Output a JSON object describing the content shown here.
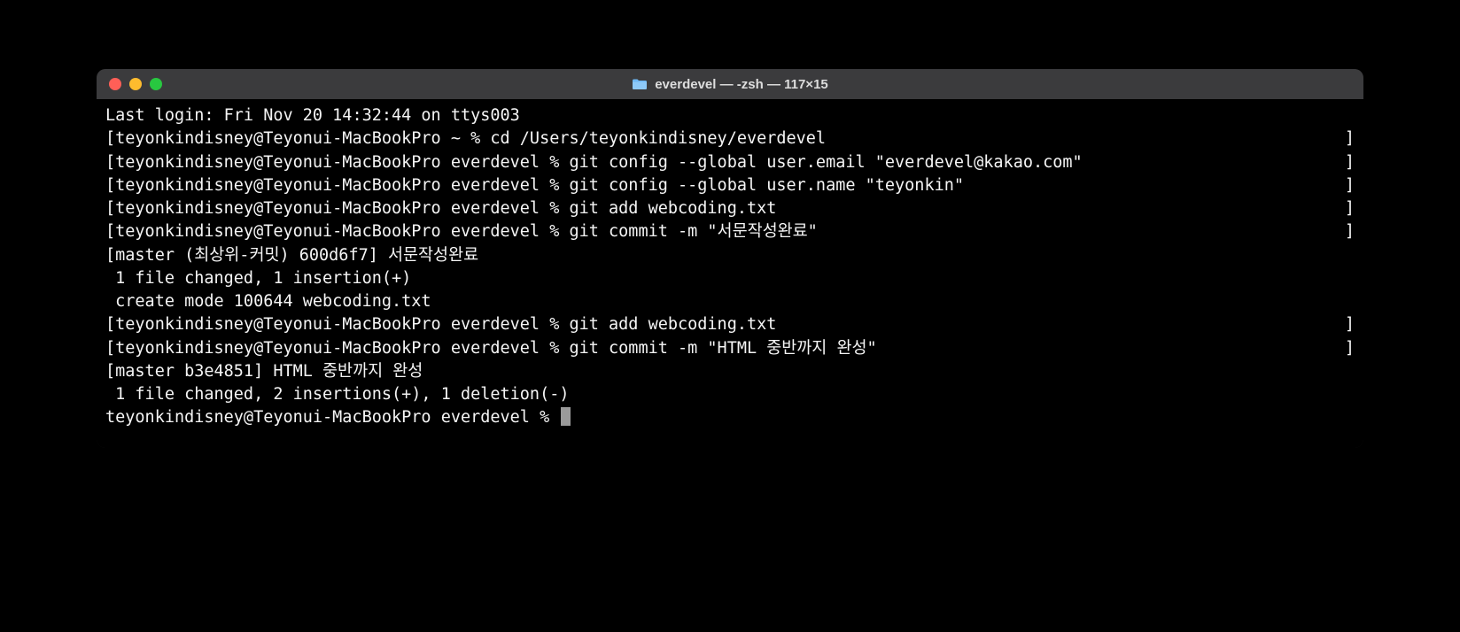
{
  "window": {
    "title": "everdevel — -zsh — 117×15"
  },
  "terminal": {
    "lines": [
      {
        "type": "plain",
        "text": "Last login: Fri Nov 20 14:32:44 on ttys003"
      },
      {
        "type": "bracket",
        "left": "[teyonkindisney@Teyonui-MacBookPro ~ % cd /Users/teyonkindisney/everdevel",
        "right": "]"
      },
      {
        "type": "bracket",
        "left": "[teyonkindisney@Teyonui-MacBookPro everdevel % git config --global user.email \"everdevel@kakao.com\"",
        "right": "]"
      },
      {
        "type": "bracket",
        "left": "[teyonkindisney@Teyonui-MacBookPro everdevel % git config --global user.name \"teyonkin\"",
        "right": "]"
      },
      {
        "type": "bracket",
        "left": "[teyonkindisney@Teyonui-MacBookPro everdevel % git add webcoding.txt",
        "right": "]"
      },
      {
        "type": "bracket",
        "left": "[teyonkindisney@Teyonui-MacBookPro everdevel % git commit -m \"서문작성완료\"",
        "right": "]"
      },
      {
        "type": "plain",
        "text": "[master (최상위-커밋) 600d6f7] 서문작성완료"
      },
      {
        "type": "plain",
        "text": " 1 file changed, 1 insertion(+)"
      },
      {
        "type": "plain",
        "text": " create mode 100644 webcoding.txt"
      },
      {
        "type": "bracket",
        "left": "[teyonkindisney@Teyonui-MacBookPro everdevel % git add webcoding.txt",
        "right": "]"
      },
      {
        "type": "bracket",
        "left": "[teyonkindisney@Teyonui-MacBookPro everdevel % git commit -m \"HTML 중반까지 완성\"",
        "right": "]"
      },
      {
        "type": "plain",
        "text": "[master b3e4851] HTML 중반까지 완성"
      },
      {
        "type": "plain",
        "text": " 1 file changed, 2 insertions(+), 1 deletion(-)"
      },
      {
        "type": "prompt",
        "text": "teyonkindisney@Teyonui-MacBookPro everdevel % "
      }
    ]
  }
}
